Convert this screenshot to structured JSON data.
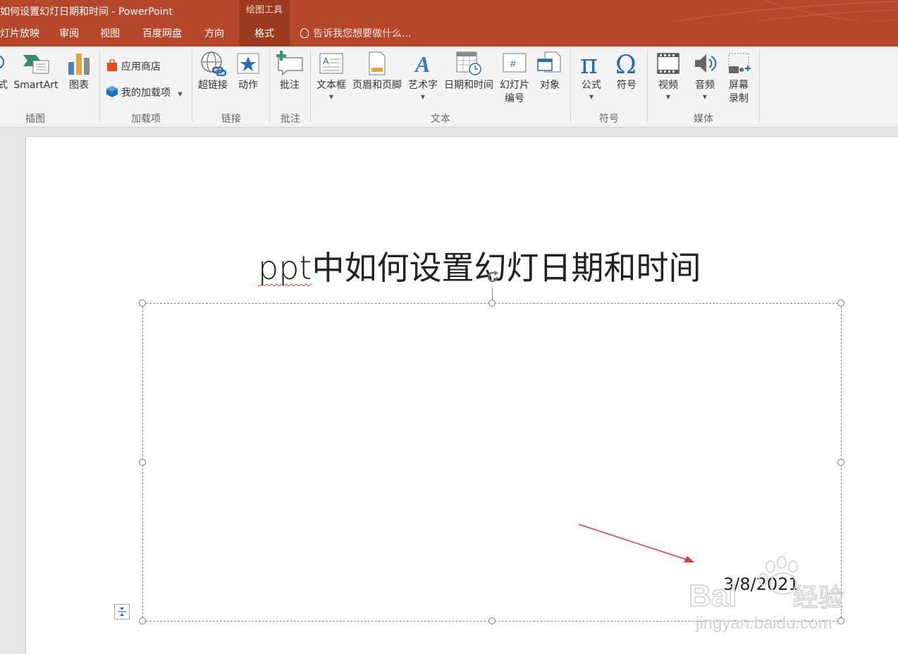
{
  "window": {
    "title": "如何设置幻灯日期和时间 - PowerPoint",
    "contextual_tab_title": "绘图工具"
  },
  "tabs": [
    {
      "label": "灯片放映"
    },
    {
      "label": "审阅"
    },
    {
      "label": "视图"
    },
    {
      "label": "百度网盘"
    },
    {
      "label": "方向"
    },
    {
      "label": "格式",
      "active": true
    }
  ],
  "tell_me": "告诉我您想要做什么...",
  "ribbon": {
    "illustrations": {
      "partial_label": "式",
      "smartart": "SmartArt",
      "chart": "图表",
      "group": "插图"
    },
    "addins": {
      "store": "应用商店",
      "my_addins": "我的加载项",
      "group": "加载项"
    },
    "links": {
      "hyperlink": "超链接",
      "action": "动作",
      "group": "链接"
    },
    "comments": {
      "comment": "批注",
      "group": "批注"
    },
    "text": {
      "textbox": "文本框",
      "header_footer": "页眉和页脚",
      "wordart": "艺术字",
      "datetime": "日期和时间",
      "slide_number_1": "幻灯片",
      "slide_number_2": "编号",
      "object": "对象",
      "group": "文本"
    },
    "symbols": {
      "equation": "公式",
      "symbol": "符号",
      "group": "符号"
    },
    "media": {
      "video": "视频",
      "audio": "音频",
      "screen_rec_1": "屏幕",
      "screen_rec_2": "录制",
      "group": "媒体"
    }
  },
  "slide": {
    "title_ppt": "ppt",
    "title_rest": "中如何设置幻灯日期和时间",
    "date": "3/8/2021"
  },
  "colors": {
    "accent": "#b7472a",
    "accent_dark": "#9c3a20",
    "arrow": "#e03a3a"
  },
  "watermark": {
    "brand": "Bai",
    "brand_cn": "经验",
    "url": "jingyan.baidu.com"
  }
}
